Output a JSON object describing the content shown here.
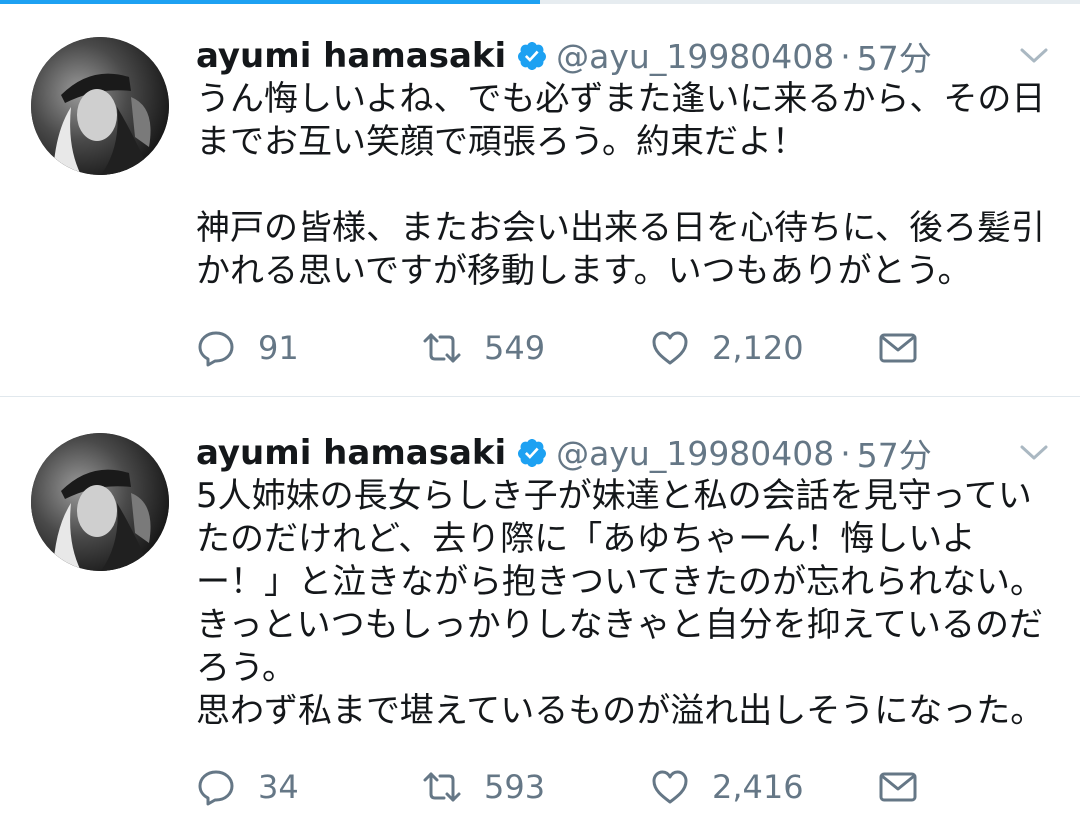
{
  "progress": 0.5,
  "tweets": [
    {
      "name": "ayumi hamasaki",
      "handle": "@ayu_19980408",
      "separator": "·",
      "time": "57分",
      "text": "うん悔しいよね、でも必ずまた逢いに来るから、その日\nまでお互い笑顔で頑張ろう。約束だよ！\n\n神戸の皆様、またお会い出来る日を心待ちに、後ろ髪引\nかれる思いですが移動します。いつもありがとう。",
      "replies": "91",
      "retweets": "549",
      "likes": "2,120"
    },
    {
      "name": "ayumi hamasaki",
      "handle": "@ayu_19980408",
      "separator": "·",
      "time": "57分",
      "text": "5人姉妹の長女らしき子が妹達と私の会話を見守ってい\nたのだけれど、去り際に「あゆちゃーん！悔しいよ\nー！」と泣きながら抱きついてきたのが忘れられない。\nきっといつもしっかりしなきゃと自分を抑えているのだ\nろう。\n思わず私まで堪えているものが溢れ出しそうになった。",
      "replies": "34",
      "retweets": "593",
      "likes": "2,416"
    }
  ],
  "colors": {
    "accent": "#1da1f2",
    "text": "#14171a",
    "secondary": "#657786",
    "divider": "#e1e8ed"
  },
  "icons": [
    "verified-badge-icon",
    "chevron-down-icon",
    "reply-icon",
    "retweet-icon",
    "like-icon",
    "direct-message-icon"
  ]
}
